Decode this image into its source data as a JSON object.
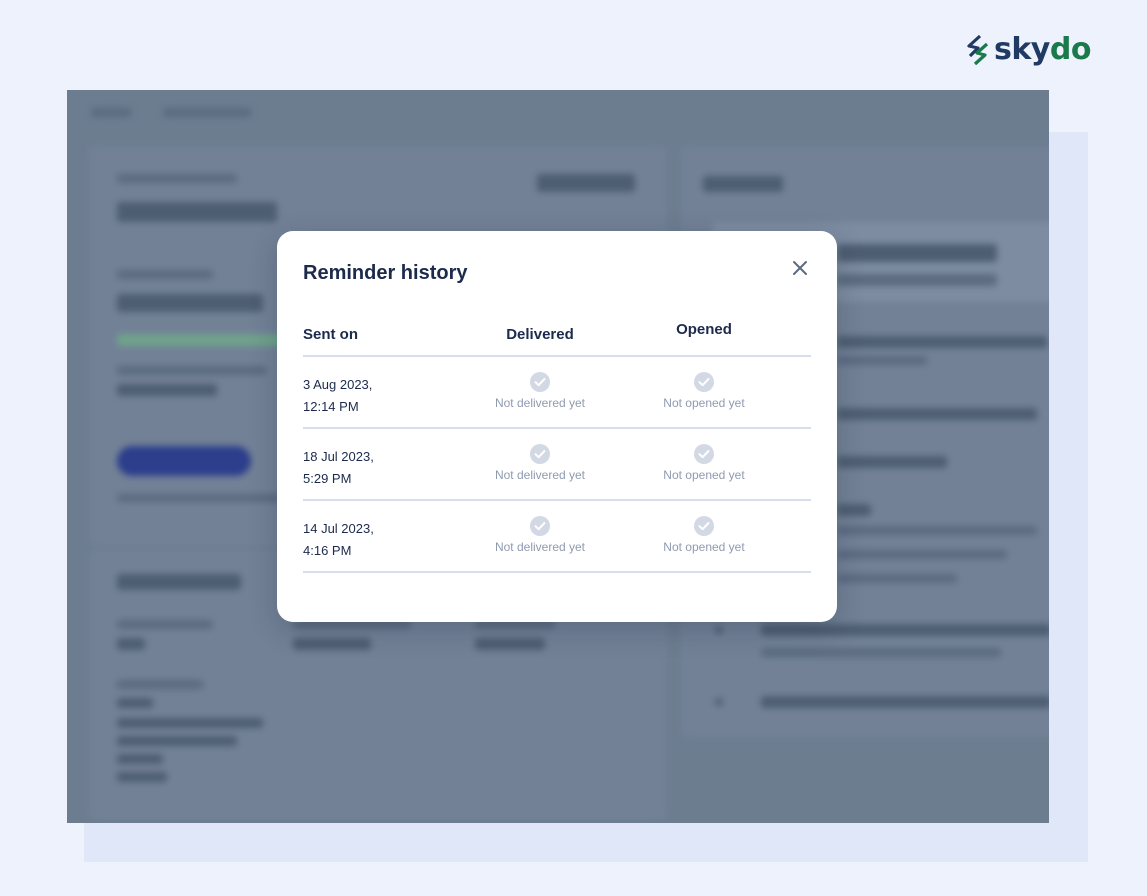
{
  "logo": {
    "text_main": "sky",
    "text_accent": "do"
  },
  "modal": {
    "title": "Reminder history",
    "close_icon": "close-icon",
    "columns": [
      "Sent on",
      "Delivered",
      "Opened"
    ],
    "rows": [
      {
        "date": "3 Aug 2023,",
        "time": "12:14 PM",
        "delivered": "Not delivered yet",
        "opened": "Not opened yet"
      },
      {
        "date": "18 Jul 2023,",
        "time": "5:29 PM",
        "delivered": "Not delivered yet",
        "opened": "Not opened yet"
      },
      {
        "date": "14 Jul 2023,",
        "time": "4:16 PM",
        "delivered": "Not delivered yet",
        "opened": "Not opened yet"
      }
    ],
    "status_icon": "check-circle-icon"
  },
  "colors": {
    "page_bg": "#eef2fc",
    "title": "#1c2a4c",
    "muted": "#8f9ab0",
    "divider": "#d7dfec",
    "check": "#d3d9e4",
    "logo_blue": "#1f3b64",
    "logo_green": "#1a7a4b"
  }
}
